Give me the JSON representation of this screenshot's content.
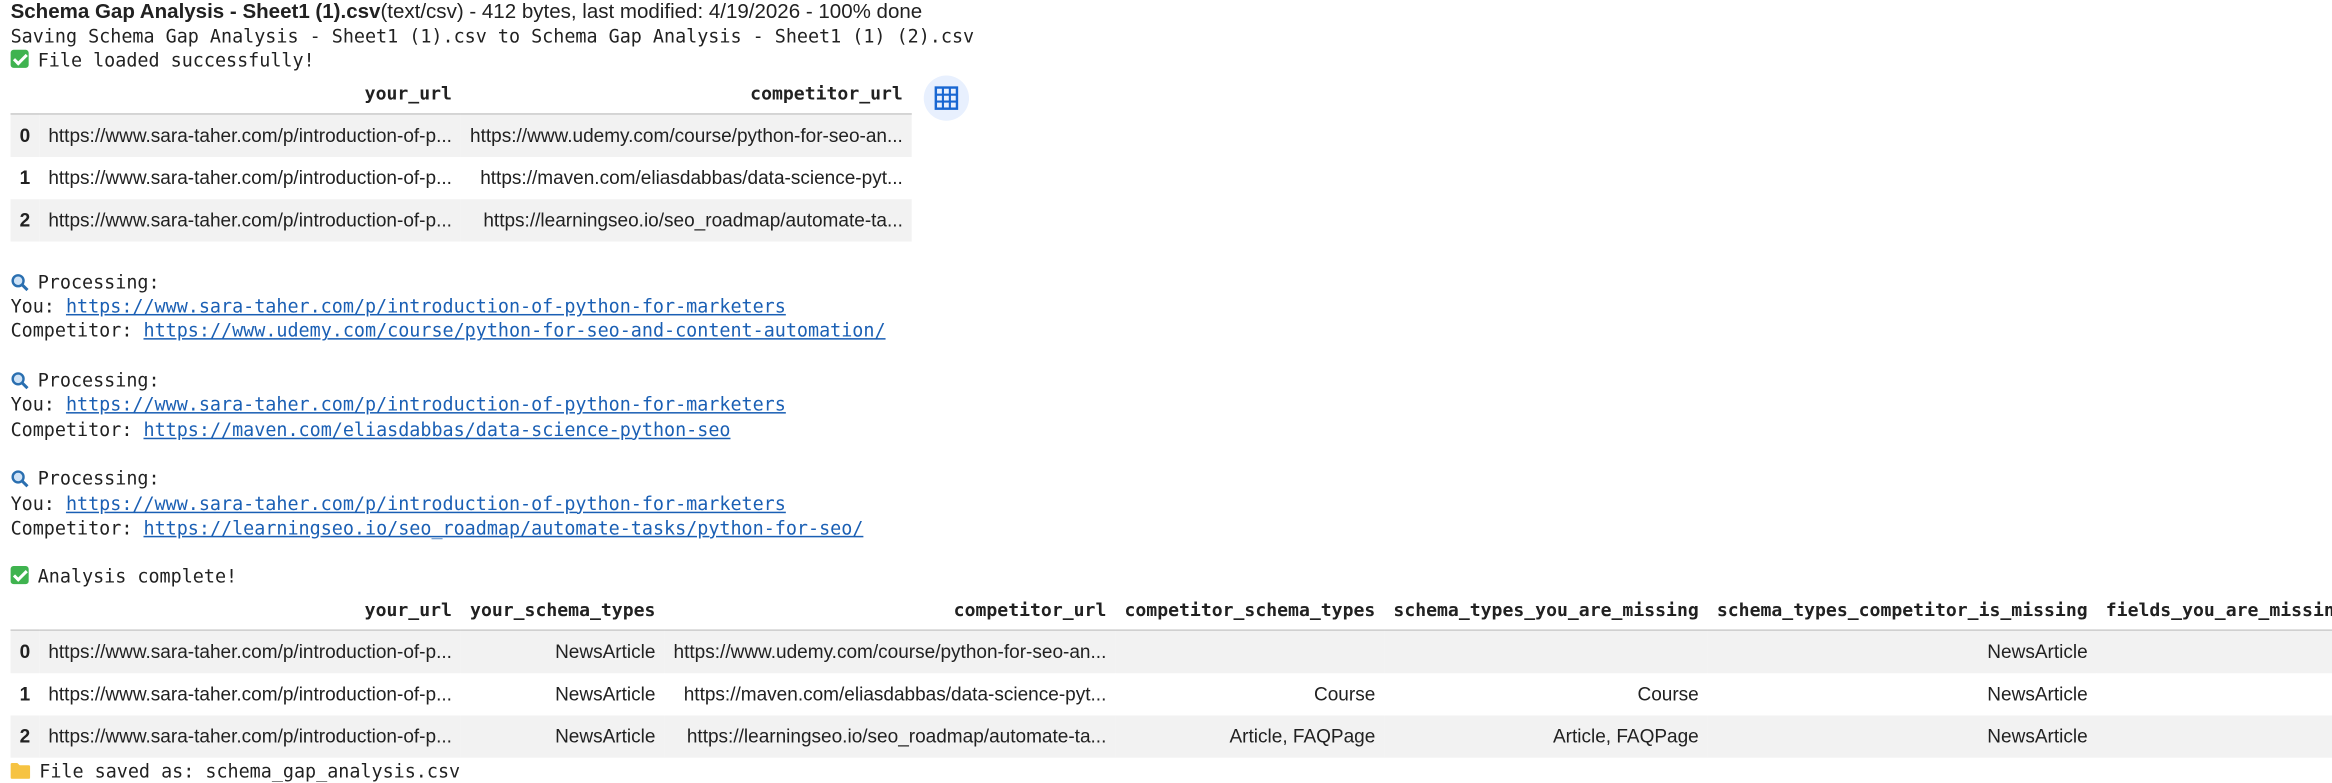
{
  "upload": {
    "filename": "Schema Gap Analysis - Sheet1 (1).csv",
    "meta": "(text/csv) - 412 bytes, last modified: 4/19/2026 - 100% done"
  },
  "saving_line": "Saving Schema Gap Analysis - Sheet1 (1).csv to Schema Gap Analysis - Sheet1 (1) (2).csv",
  "loaded_msg": "File loaded successfully!",
  "table1": {
    "columns": [
      "your_url",
      "competitor_url"
    ],
    "rows": [
      {
        "idx": "0",
        "your_url": "https://www.sara-taher.com/p/introduction-of-p...",
        "competitor_url": "https://www.udemy.com/course/python-for-seo-an..."
      },
      {
        "idx": "1",
        "your_url": "https://www.sara-taher.com/p/introduction-of-p...",
        "competitor_url": "https://maven.com/eliasdabbas/data-science-pyt..."
      },
      {
        "idx": "2",
        "your_url": "https://www.sara-taher.com/p/introduction-of-p...",
        "competitor_url": "https://learningseo.io/seo_roadmap/automate-ta..."
      }
    ]
  },
  "processing": [
    {
      "label": "Processing:",
      "you_label": "You: ",
      "you_url": "https://www.sara-taher.com/p/introduction-of-python-for-marketers",
      "comp_label": "Competitor: ",
      "comp_url": "https://www.udemy.com/course/python-for-seo-and-content-automation/"
    },
    {
      "label": "Processing:",
      "you_label": "You: ",
      "you_url": "https://www.sara-taher.com/p/introduction-of-python-for-marketers",
      "comp_label": "Competitor: ",
      "comp_url": "https://maven.com/eliasdabbas/data-science-python-seo"
    },
    {
      "label": "Processing:",
      "you_label": "You: ",
      "you_url": "https://www.sara-taher.com/p/introduction-of-python-for-marketers",
      "comp_label": "Competitor: ",
      "comp_url": "https://learningseo.io/seo_roadmap/automate-tasks/python-for-seo/"
    }
  ],
  "complete_msg": "Analysis complete!",
  "table2": {
    "columns": [
      "your_url",
      "your_schema_types",
      "competitor_url",
      "competitor_schema_types",
      "schema_types_you_are_missing",
      "schema_types_competitor_is_missing",
      "fields_you_are_missing"
    ],
    "rows": [
      {
        "idx": "0",
        "your_url": "https://www.sara-taher.com/p/introduction-of-p...",
        "your_schema_types": "NewsArticle",
        "competitor_url": "https://www.udemy.com/course/python-for-seo-an...",
        "competitor_schema_types": "",
        "schema_types_you_are_missing": "",
        "schema_types_competitor_is_missing": "NewsArticle",
        "fields_you_are_missing": ""
      },
      {
        "idx": "1",
        "your_url": "https://www.sara-taher.com/p/introduction-of-p...",
        "your_schema_types": "NewsArticle",
        "competitor_url": "https://maven.com/eliasdabbas/data-science-pyt...",
        "competitor_schema_types": "Course",
        "schema_types_you_are_missing": "Course",
        "schema_types_competitor_is_missing": "NewsArticle",
        "fields_you_are_missing": ""
      },
      {
        "idx": "2",
        "your_url": "https://www.sara-taher.com/p/introduction-of-p...",
        "your_schema_types": "NewsArticle",
        "competitor_url": "https://learningseo.io/seo_roadmap/automate-ta...",
        "competitor_schema_types": "Article, FAQPage",
        "schema_types_you_are_missing": "Article, FAQPage",
        "schema_types_competitor_is_missing": "NewsArticle",
        "fields_you_are_missing": ""
      }
    ]
  },
  "saved_msg": "File saved as: schema_gap_analysis.csv",
  "icons": {
    "check": "white-check-mark-icon",
    "magnify": "magnifying-glass-icon",
    "folder": "folder-icon",
    "table_button": "table-grid-icon"
  },
  "colors": {
    "link": "#1a5fb4",
    "check_green": "#3fb34f",
    "folder_yellow": "#f6c342",
    "row_stripe": "#f2f2f2",
    "table_button_bg": "#e8f0fe",
    "table_button_icon": "#1967d2"
  }
}
